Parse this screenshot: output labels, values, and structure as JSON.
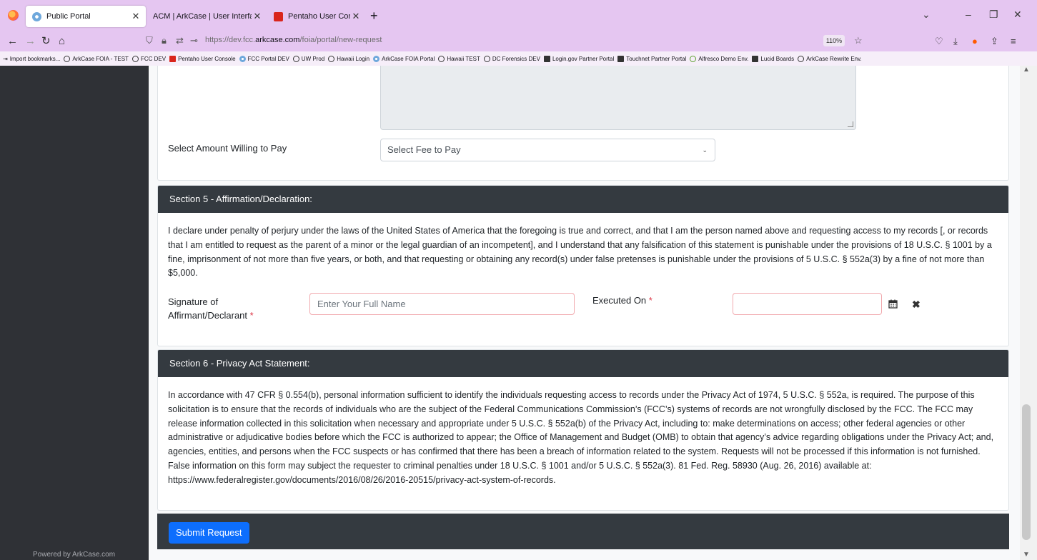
{
  "browser": {
    "tabs": [
      {
        "label": "Public Portal",
        "icon": "portal-icon",
        "active": true
      },
      {
        "label": "ACM | ArkCase | User Interface",
        "icon": "",
        "active": false
      },
      {
        "label": "Pentaho User Console",
        "icon": "pentaho-icon",
        "active": false
      }
    ],
    "url_prefix": "https://dev.fcc.",
    "url_domain": "arkcase.com",
    "url_path": "/foia/portal/new-request",
    "zoom": "110%",
    "bookmarks": [
      "Import bookmarks...",
      "ArkCase FOIA - TEST",
      "FCC DEV",
      "Pentaho User Console",
      "FCC Portal DEV",
      "UW Prod",
      "Hawaii Login",
      "ArkCase FOIA Portal",
      "Hawaii TEST",
      "DC Forensics DEV",
      "Login.gov Partner Portal",
      "Touchnet Partner Portal",
      "Alfresco Demo Env.",
      "Lucid Boards",
      "ArkCase Rewrite Env."
    ]
  },
  "sidebar": {
    "powered_by": "Powered by ArkCase.com"
  },
  "fee": {
    "label": "Select Amount Willing to Pay",
    "selected": "Select Fee to Pay"
  },
  "section5": {
    "title": "Section 5 - Affirmation/Declaration:",
    "text": "I declare under penalty of perjury under the laws of the United States of America that the foregoing is true and correct, and that I am the person named above and requesting access to my records [, or records that I am entitled to request as the parent of a minor or the legal guardian of an incompetent], and I understand that any falsification of this statement is punishable under the provisions of 18 U.S.C. § 1001 by a fine, imprisonment of not more than five years, or both, and that requesting or obtaining any record(s) under false pretenses is punishable under the provisions of 5 U.S.C. § 552a(3) by a fine of not more than $5,000.",
    "signature_label_line1": "Signature of",
    "signature_label_line2": "Affirmant/Declarant",
    "signature_placeholder": "Enter Your Full Name",
    "executed_label": "Executed On",
    "executed_value": "",
    "required_mark": "*"
  },
  "section6": {
    "title": "Section 6 - Privacy Act Statement:",
    "text": "In accordance with 47 CFR § 0.554(b), personal information sufficient to identify the individuals requesting access to records under the Privacy Act of 1974, 5 U.S.C. § 552a, is required. The purpose of this solicitation is to ensure that the records of individuals who are the subject of the Federal Communications Commission’s (FCC’s) systems of records are not wrongfully disclosed by the FCC. The FCC may release information collected in this solicitation when necessary and appropriate under 5 U.S.C. § 552a(b) of the Privacy Act, including to: make determinations on access; other federal agencies or other administrative or adjudicative bodies before which the FCC is authorized to appear; the Office of Management and Budget (OMB) to obtain that agency’s advice regarding obligations under the Privacy Act; and, agencies, entities, and persons when the FCC suspects or has confirmed that there has been a breach of information related to the system. Requests will not be processed if this information is not furnished. False information on this form may subject the requester to criminal penalties under 18 U.S.C. § 1001 and/or 5 U.S.C. § 552a(3). 81 Fed. Reg. 58930 (Aug. 26, 2016) available at: https://www.federalregister.gov/documents/2016/08/26/2016-20515/privacy-act-system-of-records."
  },
  "submit_label": "Submit Request"
}
